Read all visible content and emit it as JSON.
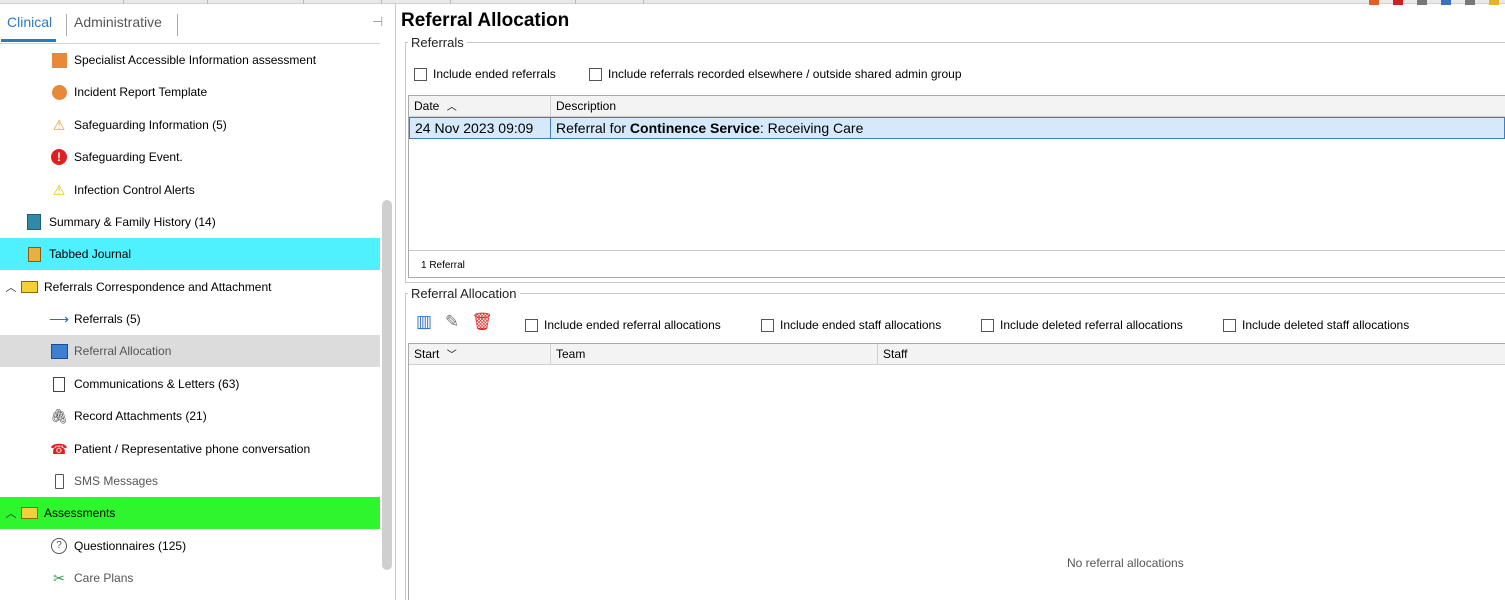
{
  "left_tabs": {
    "clinical": "Clinical",
    "administrative": "Administrative"
  },
  "tree": [
    {
      "label": "Specialist Accessible Information assessment",
      "icon": "orange-square-icon"
    },
    {
      "label": "Incident Report Template",
      "icon": "orange-circle-icon"
    },
    {
      "label": "Safeguarding Information (5)",
      "icon": "safeguarding-icon"
    },
    {
      "label": "Safeguarding Event.",
      "icon": "red-alert-icon"
    },
    {
      "label": "Infection Control Alerts",
      "icon": "warning-icon"
    },
    {
      "label": "Summary & Family History (14)",
      "icon": "summary-icon"
    },
    {
      "label": "Tabbed Journal",
      "icon": "journal-icon"
    },
    {
      "label": "Referrals Correspondence and Attachment",
      "icon": "folder-icon"
    },
    {
      "label": "Referrals (5)",
      "icon": "arrow-right-icon"
    },
    {
      "label": "Referral Allocation",
      "icon": "allocation-icon"
    },
    {
      "label": "Communications & Letters (63)",
      "icon": "document-icon"
    },
    {
      "label": "Record Attachments (21)",
      "icon": "paperclip-icon"
    },
    {
      "label": "Patient / Representative phone conversation",
      "icon": "phone-icon"
    },
    {
      "label": "SMS Messages",
      "icon": "mobile-icon"
    },
    {
      "label": "Assessments",
      "icon": "folder-icon"
    },
    {
      "label": "Questionnaires (125)",
      "icon": "question-icon"
    },
    {
      "label": "Care Plans",
      "icon": "care-plans-icon"
    }
  ],
  "page_title": "Referral Allocation",
  "referrals": {
    "legend": "Referrals",
    "filters": [
      "Include ended referrals",
      "Include referrals recorded elsewhere / outside shared admin group"
    ],
    "columns": [
      "Date",
      "Description"
    ],
    "rows": [
      {
        "date": "24 Nov 2023 09:09",
        "desc_pre": "Referral for ",
        "desc_bold": "Continence Service",
        "desc_post": ": Receiving Care"
      }
    ],
    "footer": "1 Referral"
  },
  "allocation": {
    "legend": "Referral Allocation",
    "filters": [
      "Include ended referral allocations",
      "Include ended staff allocations",
      "Include deleted referral allocations",
      "Include deleted staff allocations"
    ],
    "columns": [
      "Start",
      "Team",
      "Staff"
    ],
    "empty_text": "No referral allocations"
  },
  "colors": {
    "highlight_cyan": "#4ff0ff",
    "highlight_green": "#2ef52e",
    "selection": "#d6e9fb",
    "accent": "#2a7ac0"
  }
}
